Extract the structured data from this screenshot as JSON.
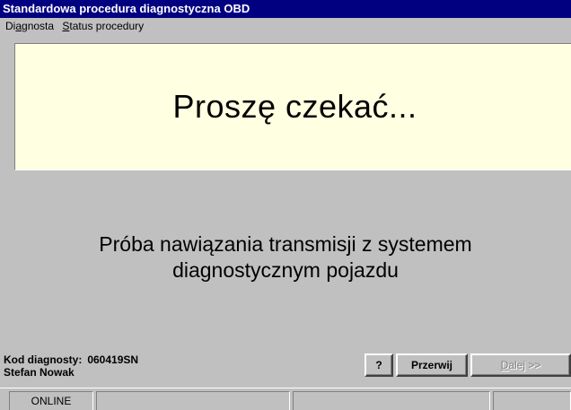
{
  "window": {
    "title": "Standardowa procedura diagnostyczna OBD"
  },
  "menu": {
    "items": [
      {
        "before": "Di",
        "accel": "a",
        "after": "gnosta"
      },
      {
        "before": "",
        "accel": "S",
        "after": "tatus procedury"
      }
    ]
  },
  "banner": {
    "text": "Proszę czekać..."
  },
  "message": {
    "line1": "Próba nawiązania transmisji z systemem",
    "line2": "diagnostycznym pojazdu"
  },
  "operator": {
    "code_label": "Kod diagnosty:",
    "code_value": "060419SN",
    "name": "Stefan Nowak"
  },
  "buttons": {
    "help": "?",
    "abort": "Przerwij",
    "next_accel": "D",
    "next_rest": "alej >>"
  },
  "statusbar": {
    "panes": [
      "ONLINE",
      "",
      "",
      ""
    ]
  },
  "colors": {
    "title_bg": "#000080",
    "face": "#c0c0c0",
    "banner_bg": "#ffffe1",
    "disabled_text": "#808080"
  }
}
